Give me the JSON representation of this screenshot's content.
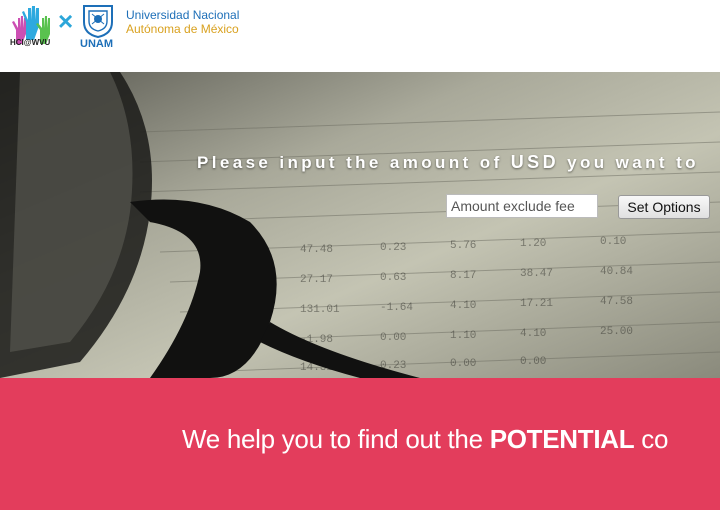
{
  "header": {
    "hci_logo_text": "HCI@WVU",
    "separator": "×",
    "unam_logo_text": "UNAM",
    "university_line_1": "Universidad Nacional",
    "university_line_2": "Autónoma de México"
  },
  "hero": {
    "prompt_prefix": "Please input the amount of",
    "prompt_currency": "USD",
    "prompt_suffix": "you want to",
    "amount_placeholder": "Amount exclude fee",
    "amount_value": "",
    "set_options_label": "Set Options"
  },
  "banner": {
    "tagline_prefix": "We help you to find out the",
    "tagline_emphasis": "POTENTIAL",
    "tagline_suffix": "co"
  },
  "colors": {
    "banner_bg": "#e33d5c",
    "unam_blue": "#1d6fb8",
    "unam_gold": "#d9a11f",
    "separator_blue": "#2ca6d9"
  }
}
